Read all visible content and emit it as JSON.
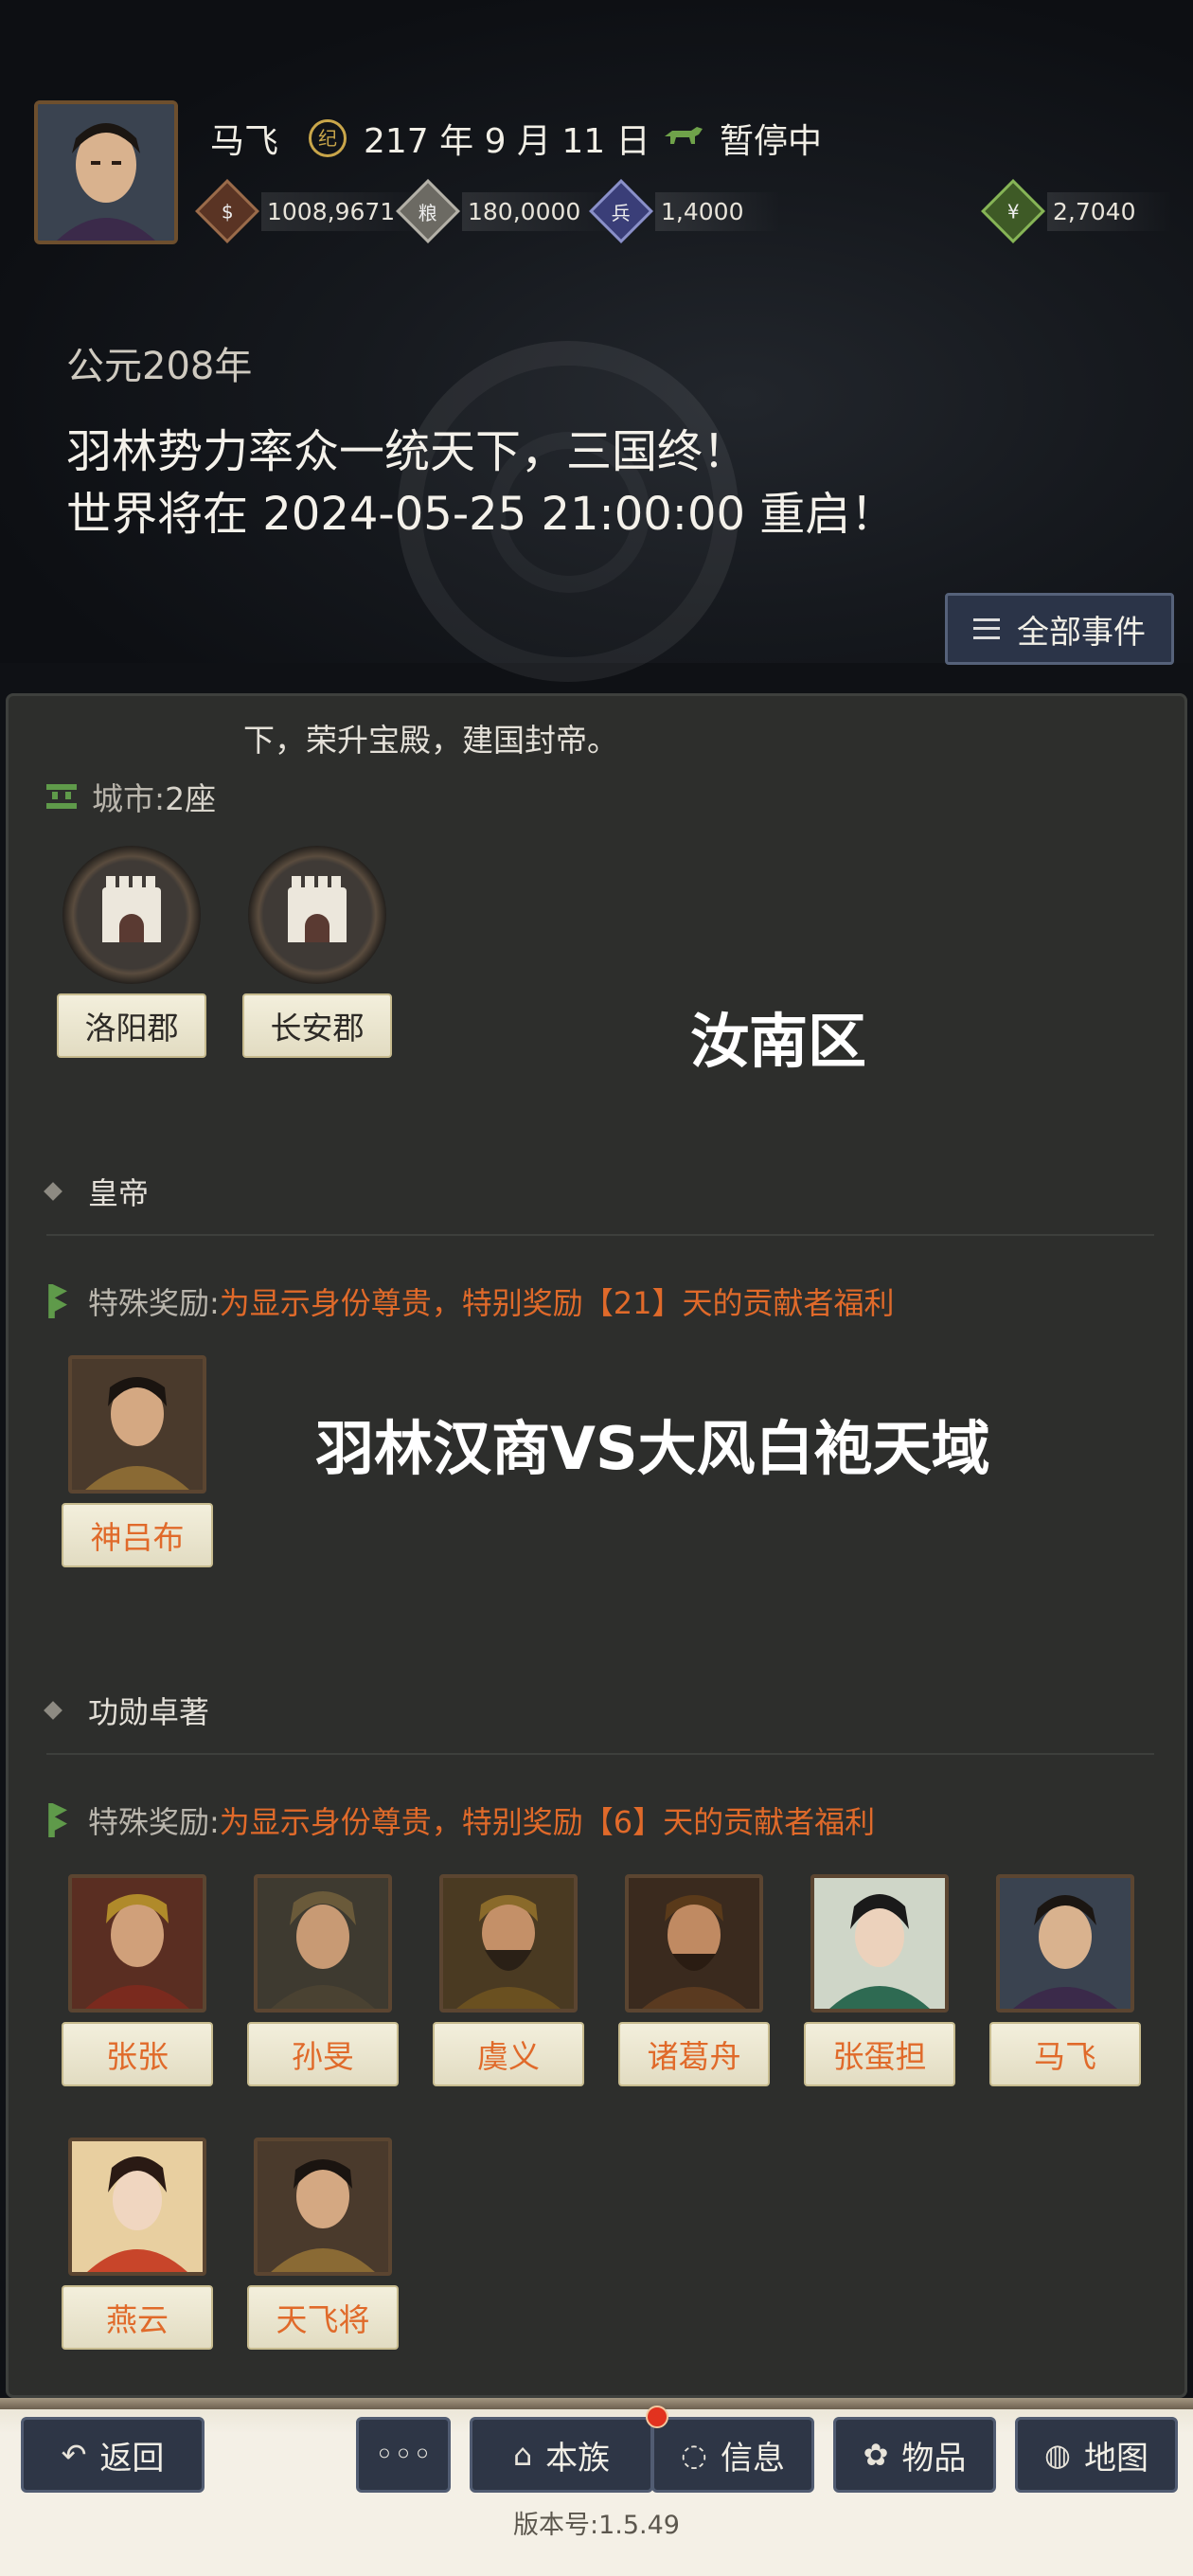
{
  "status": {
    "player_name": "马飞",
    "date_icon": "calendar-emblem-icon",
    "game_date": "217 年 9 月 11 日",
    "pause_state": "暂停中",
    "resources": [
      {
        "icon": "coin-icon",
        "value": "1008,9671"
      },
      {
        "icon": "grain-icon",
        "value": "180,0000"
      },
      {
        "icon": "troops-icon",
        "value": "1,4000"
      },
      {
        "icon": "money-bag-icon",
        "value": "2,7040"
      }
    ]
  },
  "announcement": {
    "year": "公元208年",
    "line1": "羽林势力率众一统天下，三国终！",
    "line2": "世界将在 2024-05-25 21:00:00 重启！"
  },
  "all_events_label": "全部事件",
  "panel": {
    "scroll_text": "下，荣升宝殿，建国封帝。",
    "cities_label": "城市: ",
    "cities_count": "2座",
    "cities": [
      "洛阳郡",
      "长安郡"
    ],
    "overlay_server": "汝南区",
    "overlay_match": "羽林汉商VS大风白袍天域",
    "emperor": {
      "title": "皇帝",
      "reward_label": "特殊奖励: ",
      "reward_text": "为显示身份尊贵，特别奖励【21】天的贡献者福利",
      "heroes": [
        "神吕布"
      ]
    },
    "merit": {
      "title": "功勋卓著",
      "reward_label": "特殊奖励: ",
      "reward_text": "为显示身份尊贵，特别奖励【6】天的贡献者福利",
      "heroes": [
        "张张",
        "孙旻",
        "虞义",
        "诸葛舟",
        "张蛋担",
        "马飞",
        "燕云",
        "天飞将"
      ]
    }
  },
  "bottom_bar": {
    "back": "返回",
    "more": "◦◦◦",
    "clan": "本族",
    "message": "信息",
    "items": "物品",
    "map": "地图",
    "version": "版本号:1.5.49"
  },
  "colors": {
    "accent_orange": "#e06a2a",
    "button_bg": "#2e3646",
    "panel_bg": "#2d2e2c",
    "green_icon": "#5f9a4a"
  }
}
